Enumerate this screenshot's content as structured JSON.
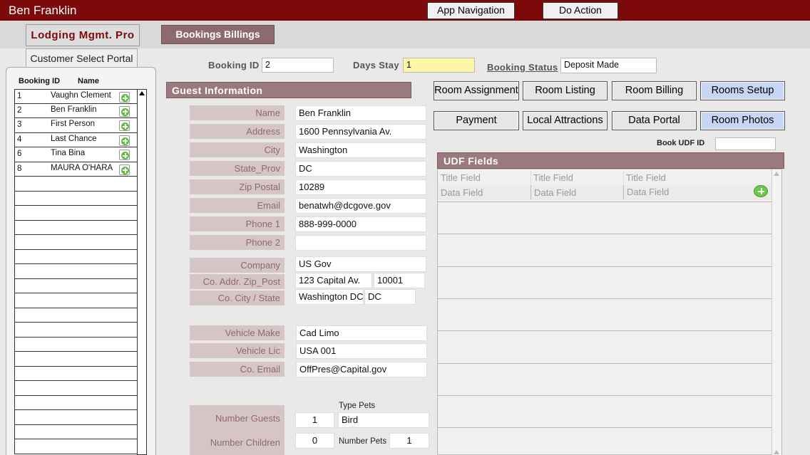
{
  "header": {
    "title": "Ben Franklin",
    "app_navigation_label": "App Navigation",
    "do_action_label": "Do Action"
  },
  "tabs": {
    "lodging": "Lodging Mgmt. Pro",
    "bookings": "Bookings Billings",
    "customer_portal": "Customer Select Portal"
  },
  "booking_list": {
    "col_id": "Booking ID",
    "col_name": "Name",
    "rows": [
      {
        "id": "1",
        "name": "Vaughn Clement"
      },
      {
        "id": "2",
        "name": "Ben Franklin"
      },
      {
        "id": "3",
        "name": "First Person"
      },
      {
        "id": "4",
        "name": "Last Chance"
      },
      {
        "id": "6",
        "name": "Tina Bina"
      },
      {
        "id": "8",
        "name": "MAURA O'HARA"
      },
      {
        "id": "",
        "name": ""
      },
      {
        "id": "",
        "name": ""
      },
      {
        "id": "",
        "name": ""
      },
      {
        "id": "",
        "name": ""
      },
      {
        "id": "",
        "name": ""
      },
      {
        "id": "",
        "name": ""
      },
      {
        "id": "",
        "name": ""
      },
      {
        "id": "",
        "name": ""
      },
      {
        "id": "",
        "name": ""
      },
      {
        "id": "",
        "name": ""
      },
      {
        "id": "",
        "name": ""
      },
      {
        "id": "",
        "name": ""
      },
      {
        "id": "",
        "name": ""
      },
      {
        "id": "",
        "name": ""
      },
      {
        "id": "",
        "name": ""
      },
      {
        "id": "",
        "name": ""
      },
      {
        "id": "",
        "name": ""
      },
      {
        "id": "",
        "name": ""
      },
      {
        "id": "",
        "name": ""
      }
    ]
  },
  "booking": {
    "id_label": "Booking ID",
    "id_value": "2",
    "days_label": "Days Stay",
    "days_value": "1",
    "status_label": "Booking Status",
    "status_value": "Deposit Made"
  },
  "guest": {
    "section_title": "Guest Information",
    "name_label": "Name",
    "name": "Ben Franklin",
    "address_label": "Address",
    "address": "1600 Pennsylvania Av.",
    "city_label": "City",
    "city": "Washington",
    "state_label": "State_Prov",
    "state": "DC",
    "zip_label": "Zip Postal",
    "zip": "10289",
    "email_label": "Email",
    "email": "benatwh@dcgove.gov",
    "phone1_label": "Phone 1",
    "phone1": "888-999-0000",
    "phone2_label": "Phone 2",
    "phone2": "",
    "company_label": "Company",
    "company": "US Gov",
    "co_addr_label": "Co. Addr. Zip_Post",
    "co_addr": "123 Capital Av.",
    "co_zip": "10001",
    "co_city_label": "Co.  City / State",
    "co_city": "Washington DC",
    "co_state": "DC",
    "vehicle_make_label": "Vehicle Make",
    "vehicle_make": "Cad Limo",
    "vehicle_lic_label": "Vehicle Lic",
    "vehicle_lic": "USA 001",
    "co_email_label": "Co. Email",
    "co_email": "OffPres@Capital.gov",
    "type_pets_label": "Type Pets",
    "type_pets": "Bird",
    "num_guests_label": "Number Guests",
    "num_guests": "1",
    "num_children_label": "Number Children",
    "num_children": "0",
    "num_pets_label": "Number Pets",
    "num_pets": "1"
  },
  "actions": {
    "room_assignment": "Room Assignment",
    "room_listing": "Room Listing",
    "room_billing": "Room Billing",
    "rooms_setup": "Rooms Setup",
    "payment": "Payment",
    "local_attractions": "Local Attractions",
    "data_portal": "Data Portal",
    "room_photos": "Room Photos"
  },
  "udf": {
    "book_udf_id_label": "Book UDF ID",
    "book_udf_id_value": "",
    "section_title": "UDF Fields",
    "title_fields": [
      "Title Field",
      "Title Field",
      "Title Field"
    ],
    "data_fields": [
      "Data Field",
      "Data Field",
      "Data Field"
    ]
  },
  "colors": {
    "header_bar": "#7d0a0a",
    "section_header": "#9a7a7e",
    "label_bg": "#d5c5c5",
    "highlight_blue": "#c8d6f5",
    "days_field": "#fdf6a6"
  }
}
